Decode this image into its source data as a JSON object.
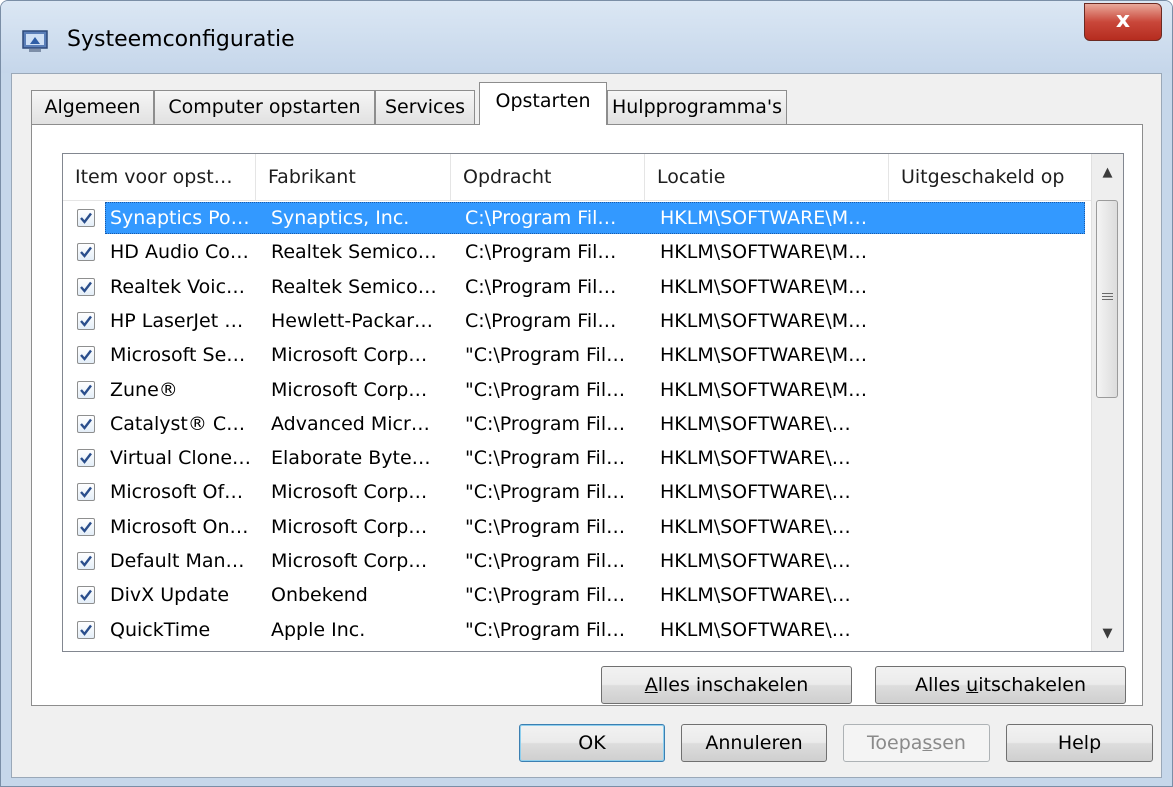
{
  "window": {
    "title": "Systeemconfiguratie"
  },
  "tabs": [
    "Algemeen",
    "Computer opstarten",
    "Services",
    "Opstarten",
    "Hulpprogramma's"
  ],
  "active_tab": "Opstarten",
  "columns": [
    "Item voor opst…",
    "Fabrikant",
    "Opdracht",
    "Locatie",
    "Uitgeschakeld op"
  ],
  "rows": [
    {
      "item": "Synaptics Po…",
      "manufacturer": "Synaptics, Inc.",
      "command": "C:\\Program Fil…",
      "location": "HKLM\\SOFTWARE\\M…",
      "disabled_on": "",
      "checked": true,
      "selected": true
    },
    {
      "item": "HD Audio Co…",
      "manufacturer": "Realtek Semico…",
      "command": "C:\\Program Fil…",
      "location": "HKLM\\SOFTWARE\\M…",
      "disabled_on": "",
      "checked": true
    },
    {
      "item": "Realtek Voic…",
      "manufacturer": "Realtek Semico…",
      "command": "C:\\Program Fil…",
      "location": "HKLM\\SOFTWARE\\M…",
      "disabled_on": "",
      "checked": true
    },
    {
      "item": "HP LaserJet …",
      "manufacturer": "Hewlett-Packar…",
      "command": "C:\\Program Fil…",
      "location": "HKLM\\SOFTWARE\\M…",
      "disabled_on": "",
      "checked": true
    },
    {
      "item": "Microsoft Se…",
      "manufacturer": "Microsoft Corp…",
      "command": "\"C:\\Program Fil…",
      "location": "HKLM\\SOFTWARE\\M…",
      "disabled_on": "",
      "checked": true
    },
    {
      "item": "Zune®",
      "manufacturer": "Microsoft Corp…",
      "command": "\"C:\\Program Fil…",
      "location": "HKLM\\SOFTWARE\\M…",
      "disabled_on": "",
      "checked": true
    },
    {
      "item": "Catalyst® C…",
      "manufacturer": "Advanced Micr…",
      "command": "\"C:\\Program Fil…",
      "location": "HKLM\\SOFTWARE\\…",
      "disabled_on": "",
      "checked": true
    },
    {
      "item": "Virtual Clone…",
      "manufacturer": "Elaborate Byte…",
      "command": "\"C:\\Program Fil…",
      "location": "HKLM\\SOFTWARE\\…",
      "disabled_on": "",
      "checked": true
    },
    {
      "item": "Microsoft Of…",
      "manufacturer": "Microsoft Corp…",
      "command": "\"C:\\Program Fil…",
      "location": "HKLM\\SOFTWARE\\…",
      "disabled_on": "",
      "checked": true
    },
    {
      "item": "Microsoft On…",
      "manufacturer": "Microsoft Corp…",
      "command": "\"C:\\Program Fil…",
      "location": "HKLM\\SOFTWARE\\…",
      "disabled_on": "",
      "checked": true
    },
    {
      "item": "Default Man…",
      "manufacturer": "Microsoft Corp…",
      "command": "\"C:\\Program Fil…",
      "location": "HKLM\\SOFTWARE\\…",
      "disabled_on": "",
      "checked": true
    },
    {
      "item": "DivX Update",
      "manufacturer": "Onbekend",
      "command": "\"C:\\Program Fil…",
      "location": "HKLM\\SOFTWARE\\…",
      "disabled_on": "",
      "checked": true
    },
    {
      "item": "QuickTime",
      "manufacturer": "Apple Inc.",
      "command": "\"C:\\Program Fil…",
      "location": "HKLM\\SOFTWARE\\…",
      "disabled_on": "",
      "checked": true
    }
  ],
  "list_buttons": {
    "enable_all": {
      "before": "",
      "accel": "A",
      "after": "lles inschakelen"
    },
    "disable_all": {
      "before": "Alles ",
      "accel": "u",
      "after": "itschakelen"
    }
  },
  "dialog_buttons": {
    "ok": "OK",
    "cancel": "Annuleren",
    "apply": {
      "before": "Toepa",
      "accel": "s",
      "after": "sen"
    },
    "help": "Help"
  },
  "close_glyph": "x",
  "icons": {
    "app": "msconfig-icon",
    "close": "close-icon",
    "checkbox": "checkmark-icon",
    "scroll_up": "scroll-up-arrow-icon",
    "scroll_down": "scroll-down-arrow-icon",
    "grip": "scroll-grip-icon"
  },
  "colors": {
    "selection": "#3399ff",
    "titlebar": "#c6d7ea",
    "close_button": "#c9473a"
  }
}
